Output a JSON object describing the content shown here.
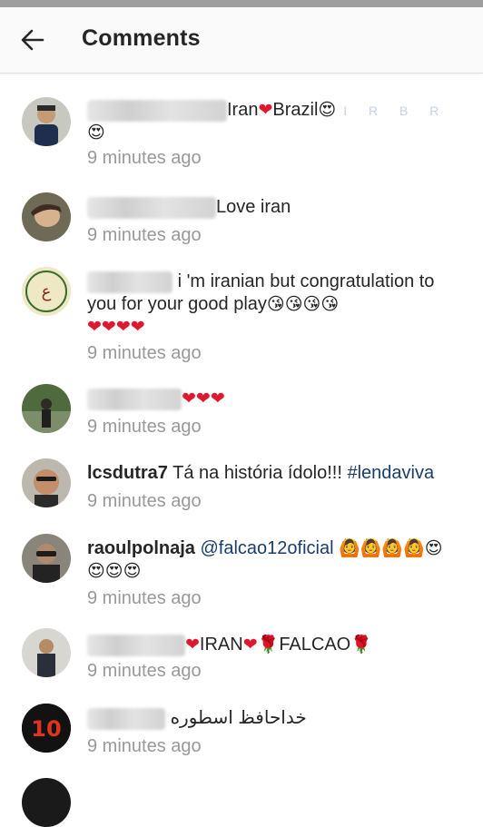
{
  "header": {
    "title": "Comments"
  },
  "comments": [
    {
      "text": "Iran",
      "text2": "Brazil",
      "heart": "❤",
      "emoji": "😍",
      "faint": "I R B R",
      "time": "9 minutes ago"
    },
    {
      "text": "Love iran",
      "time": "9 minutes ago"
    },
    {
      "text": "i 'm iranian but congratulation to you for your good play",
      "kisses": "😘😘😘😘",
      "hearts": "❤❤❤❤",
      "time": "9 minutes ago"
    },
    {
      "hearts": "❤❤❤",
      "time": "9 minutes ago"
    },
    {
      "user": "lcsdutra7",
      "text": "Tá na história ídolo!!!",
      "tag": "#lendaviva",
      "time": "9 minutes ago"
    },
    {
      "user": "raoulpolnaja",
      "mention": "@falcao12oficial",
      "emoji": "🙆🙆🙆🙆😍😍😍😍",
      "time": "9 minutes ago"
    },
    {
      "heart": "❤",
      "text": "IRAN",
      "rose": "🌹",
      "text2": "FALCAO",
      "time": "9 minutes ago"
    },
    {
      "text": "خداحافظ اسطوره",
      "avatar_text": "10",
      "time": "9 minutes ago"
    }
  ]
}
